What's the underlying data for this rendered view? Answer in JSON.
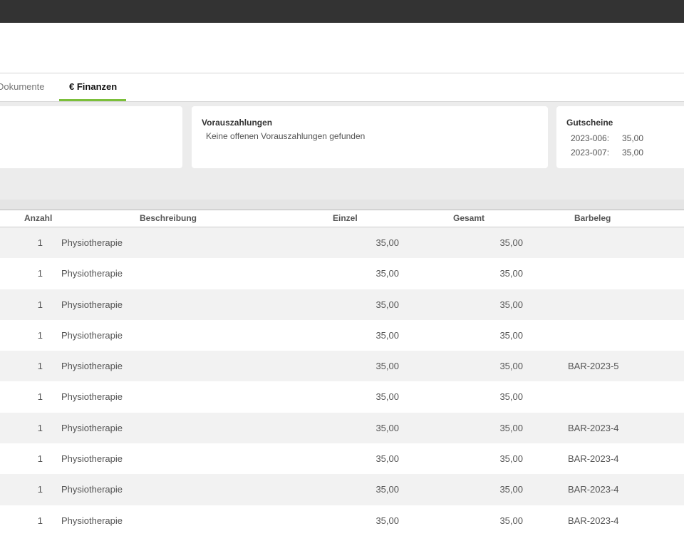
{
  "tabs": [
    {
      "label": "Dokumente"
    },
    {
      "label": "€ Finanzen"
    }
  ],
  "cards": {
    "vorauszahlungen": {
      "title": "Vorauszahlungen",
      "text": "Keine offenen Vorauszahlungen gefunden"
    },
    "gutscheine": {
      "title": "Gutscheine",
      "items": [
        {
          "number": "2023-006:",
          "amount": "35,00"
        },
        {
          "number": "2023-007:",
          "amount": "35,00"
        }
      ]
    }
  },
  "table": {
    "headers": {
      "anzahl": "Anzahl",
      "beschreibung": "Beschreibung",
      "einzel": "Einzel",
      "gesamt": "Gesamt",
      "barbeleg": "Barbeleg"
    },
    "rows": [
      {
        "anzahl": "1",
        "beschreibung": "Physiotherapie",
        "einzel": "35,00",
        "gesamt": "35,00",
        "barbeleg": ""
      },
      {
        "anzahl": "1",
        "beschreibung": "Physiotherapie",
        "einzel": "35,00",
        "gesamt": "35,00",
        "barbeleg": ""
      },
      {
        "anzahl": "1",
        "beschreibung": "Physiotherapie",
        "einzel": "35,00",
        "gesamt": "35,00",
        "barbeleg": ""
      },
      {
        "anzahl": "1",
        "beschreibung": "Physiotherapie",
        "einzel": "35,00",
        "gesamt": "35,00",
        "barbeleg": ""
      },
      {
        "anzahl": "1",
        "beschreibung": "Physiotherapie",
        "einzel": "35,00",
        "gesamt": "35,00",
        "barbeleg": "BAR-2023-5"
      },
      {
        "anzahl": "1",
        "beschreibung": "Physiotherapie",
        "einzel": "35,00",
        "gesamt": "35,00",
        "barbeleg": ""
      },
      {
        "anzahl": "1",
        "beschreibung": "Physiotherapie",
        "einzel": "35,00",
        "gesamt": "35,00",
        "barbeleg": "BAR-2023-4"
      },
      {
        "anzahl": "1",
        "beschreibung": "Physiotherapie",
        "einzel": "35,00",
        "gesamt": "35,00",
        "barbeleg": "BAR-2023-4"
      },
      {
        "anzahl": "1",
        "beschreibung": "Physiotherapie",
        "einzel": "35,00",
        "gesamt": "35,00",
        "barbeleg": "BAR-2023-4"
      },
      {
        "anzahl": "1",
        "beschreibung": "Physiotherapie",
        "einzel": "35,00",
        "gesamt": "35,00",
        "barbeleg": "BAR-2023-4"
      }
    ]
  },
  "colors": {
    "accent": "#7bbf3a",
    "topbar": "#333333"
  }
}
